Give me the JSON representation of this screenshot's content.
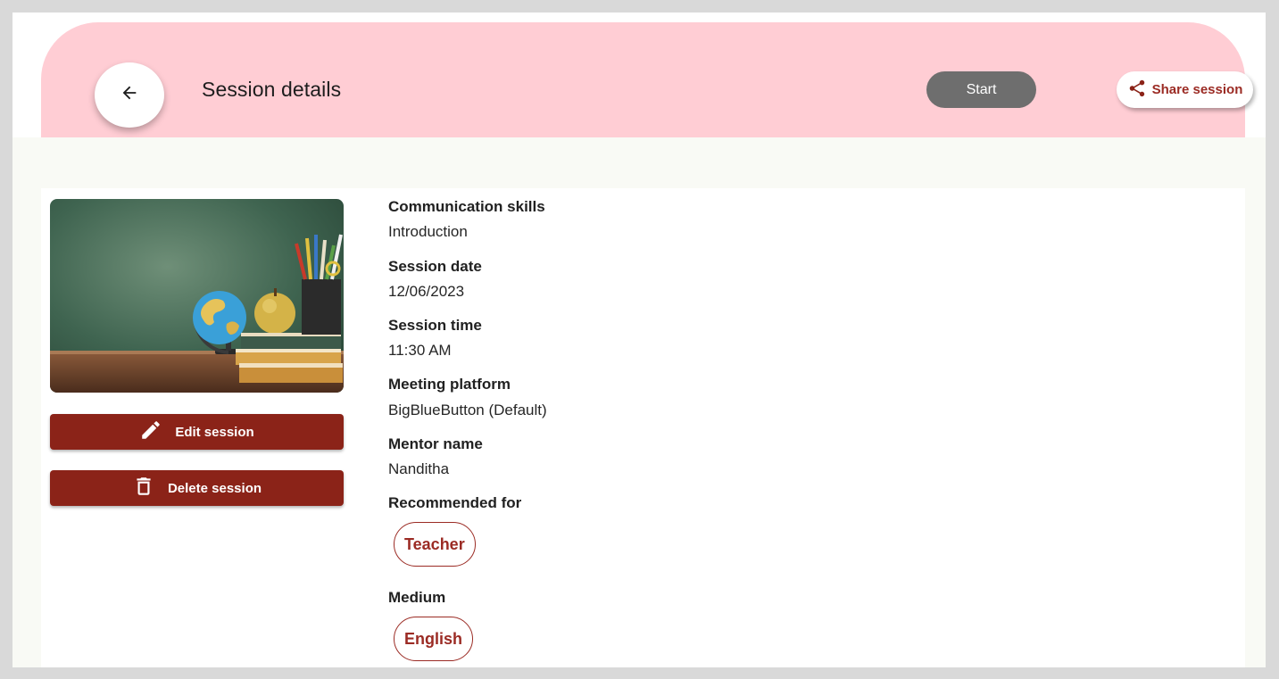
{
  "header": {
    "back_icon": "arrow-left-icon",
    "title": "Session details",
    "start_label": "Start",
    "share_icon": "share-icon",
    "share_label": "Share session"
  },
  "sidebar": {
    "image_description_icon": "classroom-cover-image",
    "edit_icon": "pencil-icon",
    "edit_label": "Edit session",
    "delete_icon": "trash-icon",
    "delete_label": "Delete session"
  },
  "session": {
    "title": "Communication skills",
    "subtitle": "Introduction",
    "date_label": "Session date",
    "date_value": "12/06/2023",
    "time_label": "Session time",
    "time_value": "11:30 AM",
    "platform_label": "Meeting platform",
    "platform_value": "BigBlueButton (Default)",
    "mentor_label": "Mentor name",
    "mentor_value": "Nanditha",
    "recommended_label": "Recommended for",
    "recommended_chip": "Teacher",
    "medium_label": "Medium",
    "medium_chip": "English"
  },
  "colors": {
    "header_bg": "#ffcdd4",
    "primary": "#8b2318",
    "accent_text": "#9b2b24",
    "start_bg": "#6e6e6e",
    "page_bg": "#f9faf5"
  }
}
